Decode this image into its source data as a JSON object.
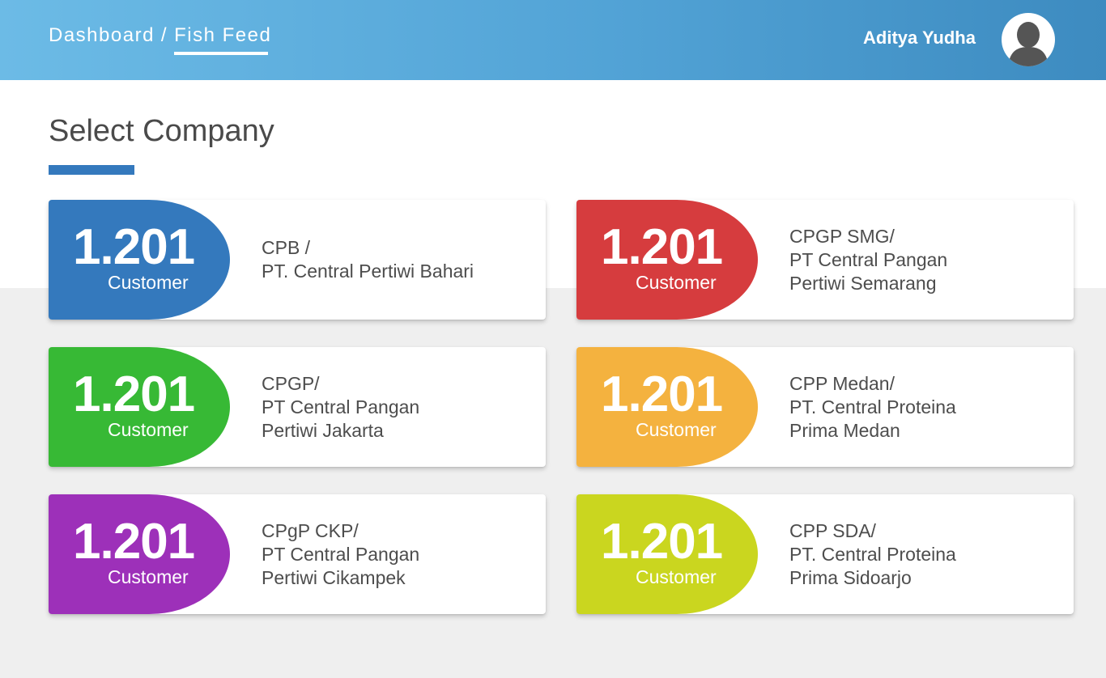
{
  "header": {
    "breadcrumb": {
      "root": "Dashboard",
      "separator": "/",
      "current": "Fish Feed"
    },
    "user_name": "Aditya Yudha",
    "avatar_icon": "user-avatar-icon"
  },
  "page": {
    "title": "Select Company",
    "accent_color": "#3479bd"
  },
  "companies": [
    {
      "count": "1.201",
      "unit": "Customer",
      "line1": "CPB /",
      "line2": "PT. Central Pertiwi Bahari",
      "line3": "",
      "color": "#3479bd"
    },
    {
      "count": "1.201",
      "unit": "Customer",
      "line1": "CPGP SMG/",
      "line2": "PT Central Pangan",
      "line3": "Pertiwi Semarang",
      "color": "#d63c3e"
    },
    {
      "count": "1.201",
      "unit": "Customer",
      "line1": "CPGP/",
      "line2": "PT Central Pangan",
      "line3": "Pertiwi Jakarta",
      "color": "#37b935"
    },
    {
      "count": "1.201",
      "unit": "Customer",
      "line1": "CPP Medan/",
      "line2": "PT. Central Proteina",
      "line3": "Prima Medan",
      "color": "#f4b23f"
    },
    {
      "count": "1.201",
      "unit": "Customer",
      "line1": "CPgP CKP/",
      "line2": "PT Central Pangan",
      "line3": "Pertiwi Cikampek",
      "color": "#9d30b9"
    },
    {
      "count": "1.201",
      "unit": "Customer",
      "line1": "CPP SDA/",
      "line2": "PT. Central Proteina",
      "line3": "Prima Sidoarjo",
      "color": "#cad61f"
    }
  ]
}
